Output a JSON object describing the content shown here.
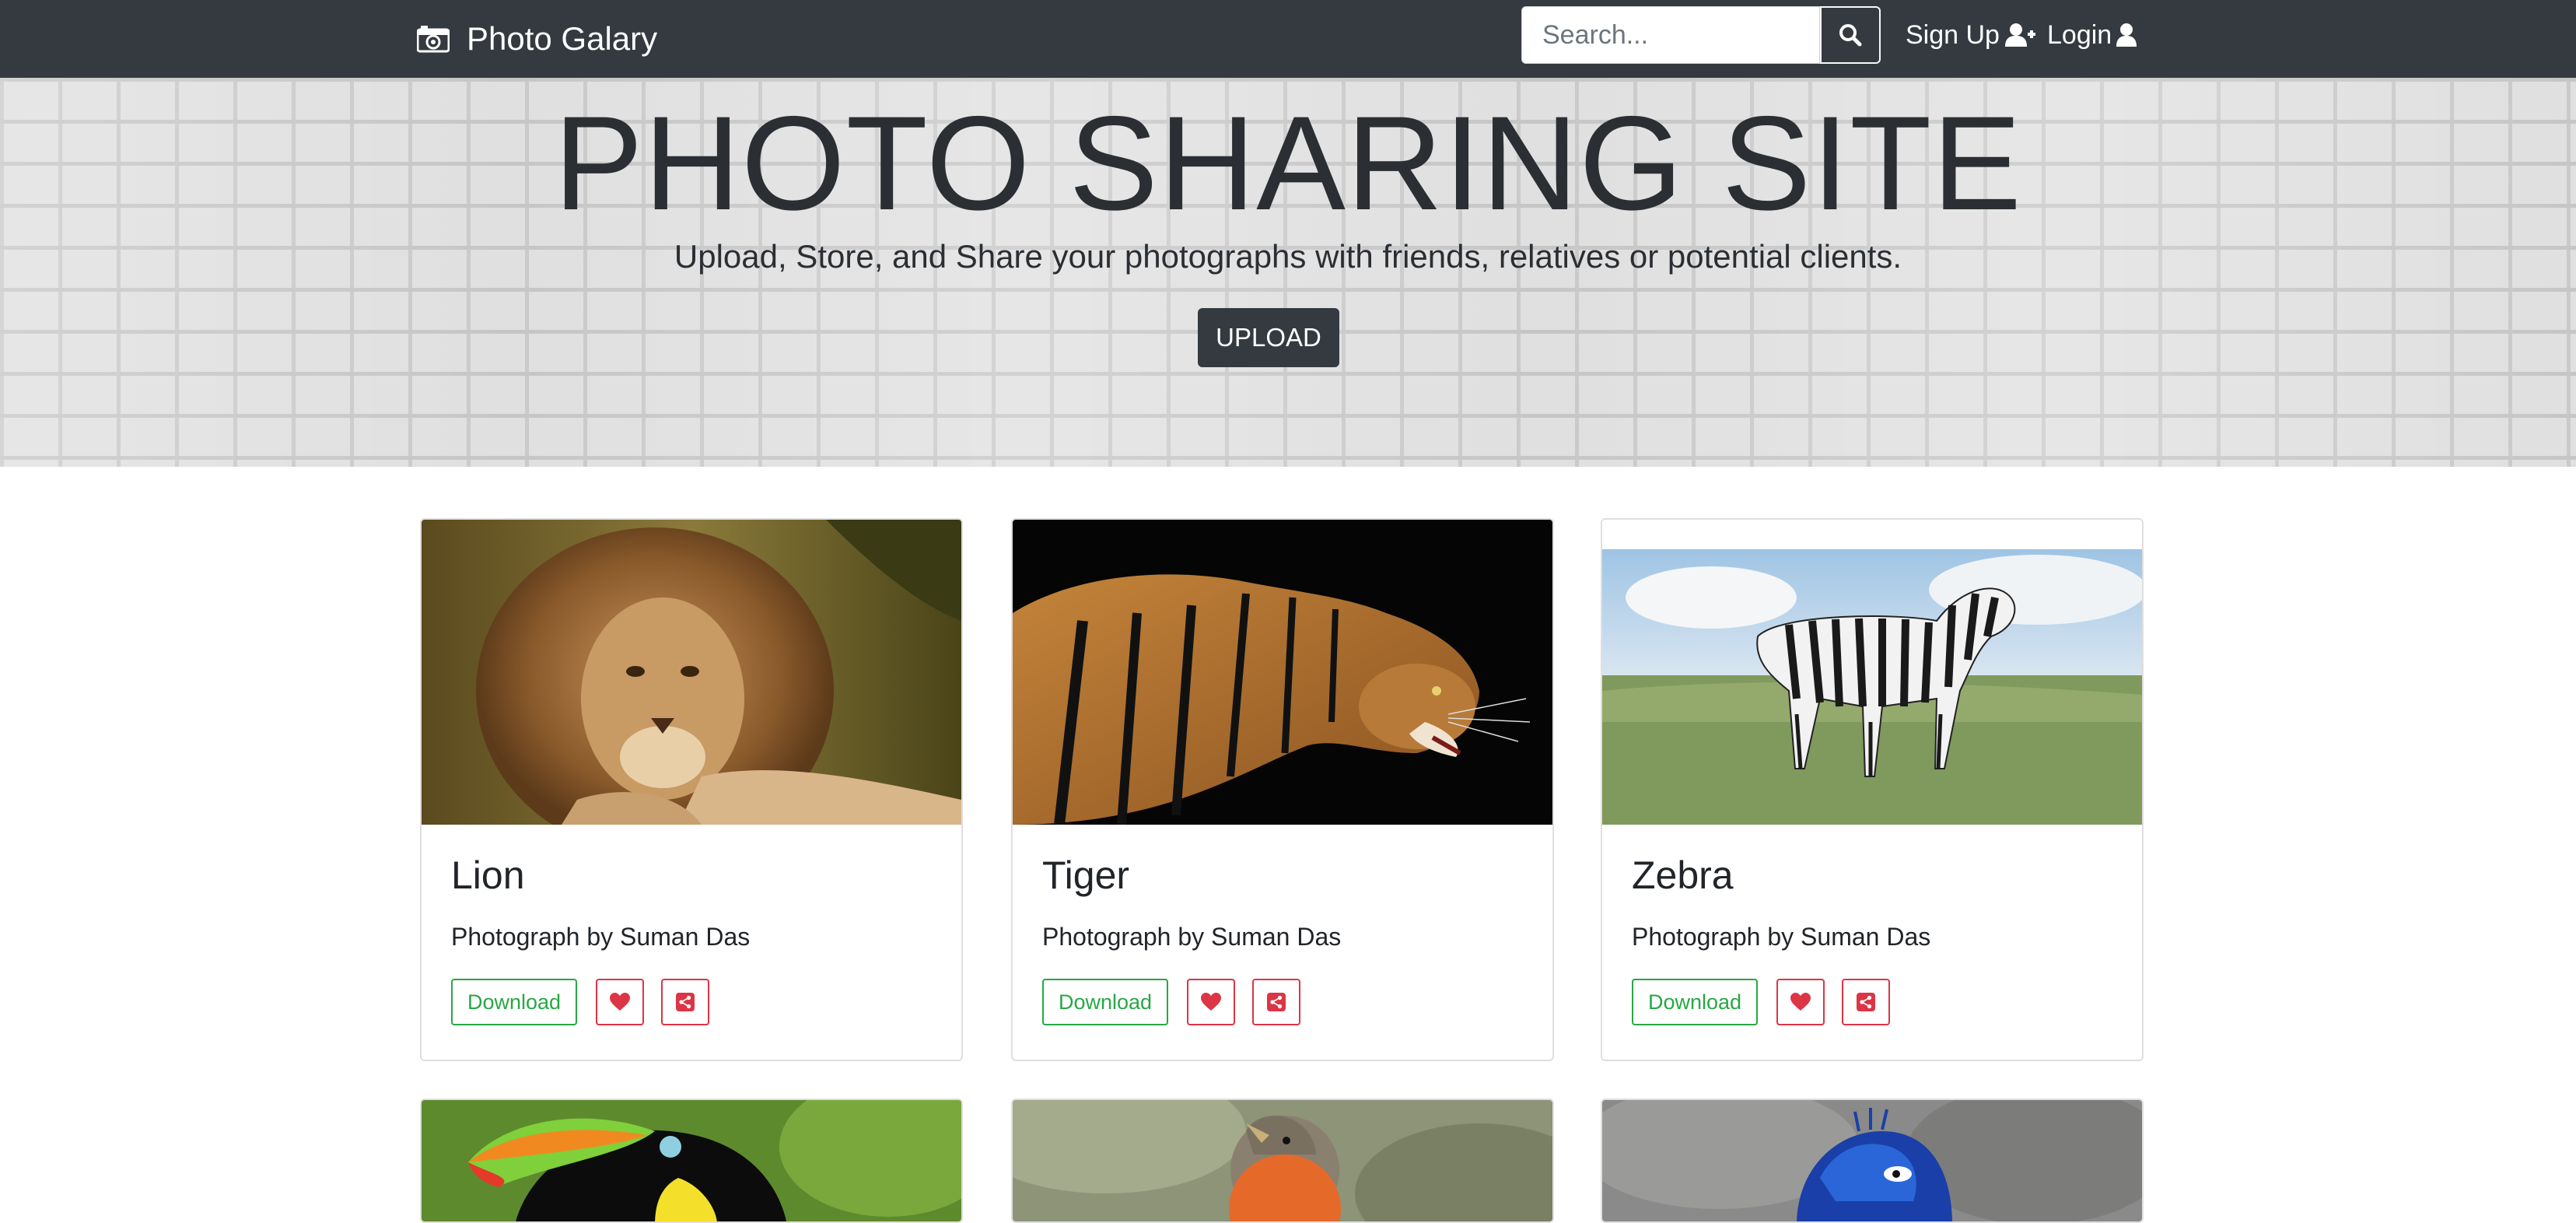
{
  "navbar": {
    "brand": "Photo Galary",
    "search_placeholder": "Search...",
    "signup_label": "Sign Up",
    "login_label": "Login"
  },
  "hero": {
    "title": "PHOTO SHARING SITE",
    "subtitle": "Upload, Store, and Share your photographs with friends, relatives or potential clients.",
    "upload_label": "UPLOAD"
  },
  "cards": [
    {
      "title": "Lion",
      "text": "Photograph by Suman Das",
      "download_label": "Download"
    },
    {
      "title": "Tiger",
      "text": "Photograph by Suman Das",
      "download_label": "Download"
    },
    {
      "title": "Zebra",
      "text": "Photograph by Suman Das",
      "download_label": "Download"
    }
  ],
  "colors": {
    "navbar": "#343a40",
    "success": "#28a745",
    "danger": "#dc3545"
  },
  "icons": [
    "camera-icon",
    "search-icon",
    "user-plus-icon",
    "user-icon",
    "heart-icon",
    "share-icon"
  ]
}
